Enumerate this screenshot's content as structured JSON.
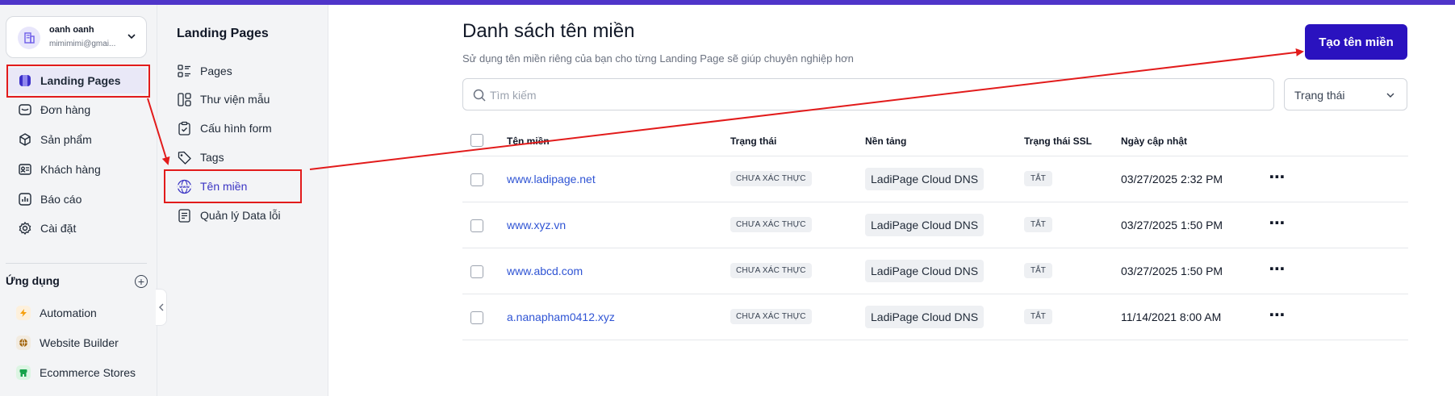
{
  "account": {
    "name": "oanh oanh",
    "email": "mimimimi@gmai..."
  },
  "sidebar": {
    "items": [
      {
        "label": "Landing Pages",
        "icon": "landing-pages-icon"
      },
      {
        "label": "Đơn hàng",
        "icon": "orders-icon"
      },
      {
        "label": "Sản phẩm",
        "icon": "box-icon"
      },
      {
        "label": "Khách hàng",
        "icon": "contact-card-icon"
      },
      {
        "label": "Báo cáo",
        "icon": "bar-chart-icon"
      },
      {
        "label": "Cài đặt",
        "icon": "gear-icon"
      }
    ],
    "apps_title": "Ứng dụng",
    "apps": [
      {
        "label": "Automation",
        "icon": "lightning-icon",
        "color": "#f59e0b"
      },
      {
        "label": "Website Builder",
        "icon": "globe-icon",
        "color": "#a16207"
      },
      {
        "label": "Ecommerce Stores",
        "icon": "store-icon",
        "color": "#16a34a"
      }
    ]
  },
  "subpanel": {
    "title": "Landing Pages",
    "items": [
      {
        "label": "Pages",
        "icon": "list-icon"
      },
      {
        "label": "Thư viện mẫu",
        "icon": "template-icon"
      },
      {
        "label": "Cấu hình form",
        "icon": "clipboard-icon"
      },
      {
        "label": "Tags",
        "icon": "tag-icon"
      },
      {
        "label": "Tên miền",
        "icon": "www-globe-icon"
      },
      {
        "label": "Quản lý Data lỗi",
        "icon": "document-icon"
      }
    ]
  },
  "main": {
    "title": "Danh sách tên miền",
    "subtitle": "Sử dụng tên miền riêng của bạn cho từng Landing Page sẽ giúp chuyên nghiệp hơn",
    "create_button": "Tạo tên miền",
    "search_placeholder": "Tìm kiếm",
    "status_filter": "Trạng thái",
    "columns": [
      "Tên miền",
      "Trạng thái",
      "Nền tảng",
      "Trạng thái SSL",
      "Ngày cập nhật"
    ],
    "rows": [
      {
        "domain": "www.ladipage.net",
        "status": "CHƯA XÁC THỰC",
        "platform": "LadiPage Cloud DNS",
        "ssl": "TẮT",
        "updated": "03/27/2025 2:32 PM"
      },
      {
        "domain": "www.xyz.vn",
        "status": "CHƯA XÁC THỰC",
        "platform": "LadiPage Cloud DNS",
        "ssl": "TẮT",
        "updated": "03/27/2025 1:50 PM"
      },
      {
        "domain": "www.abcd.com",
        "status": "CHƯA XÁC THỰC",
        "platform": "LadiPage Cloud DNS",
        "ssl": "TẮT",
        "updated": "03/27/2025 1:50 PM"
      },
      {
        "domain": "a.nanapham0412.xyz",
        "status": "CHƯA XÁC THỰC",
        "platform": "LadiPage Cloud DNS",
        "ssl": "TẮT",
        "updated": "11/14/2021 8:00 AM"
      }
    ],
    "more_label": "⋯"
  },
  "colors": {
    "accent": "#2a12bf",
    "topbar": "#4f35c9",
    "link": "#2f54d4",
    "annotation": "#e21b1b"
  }
}
